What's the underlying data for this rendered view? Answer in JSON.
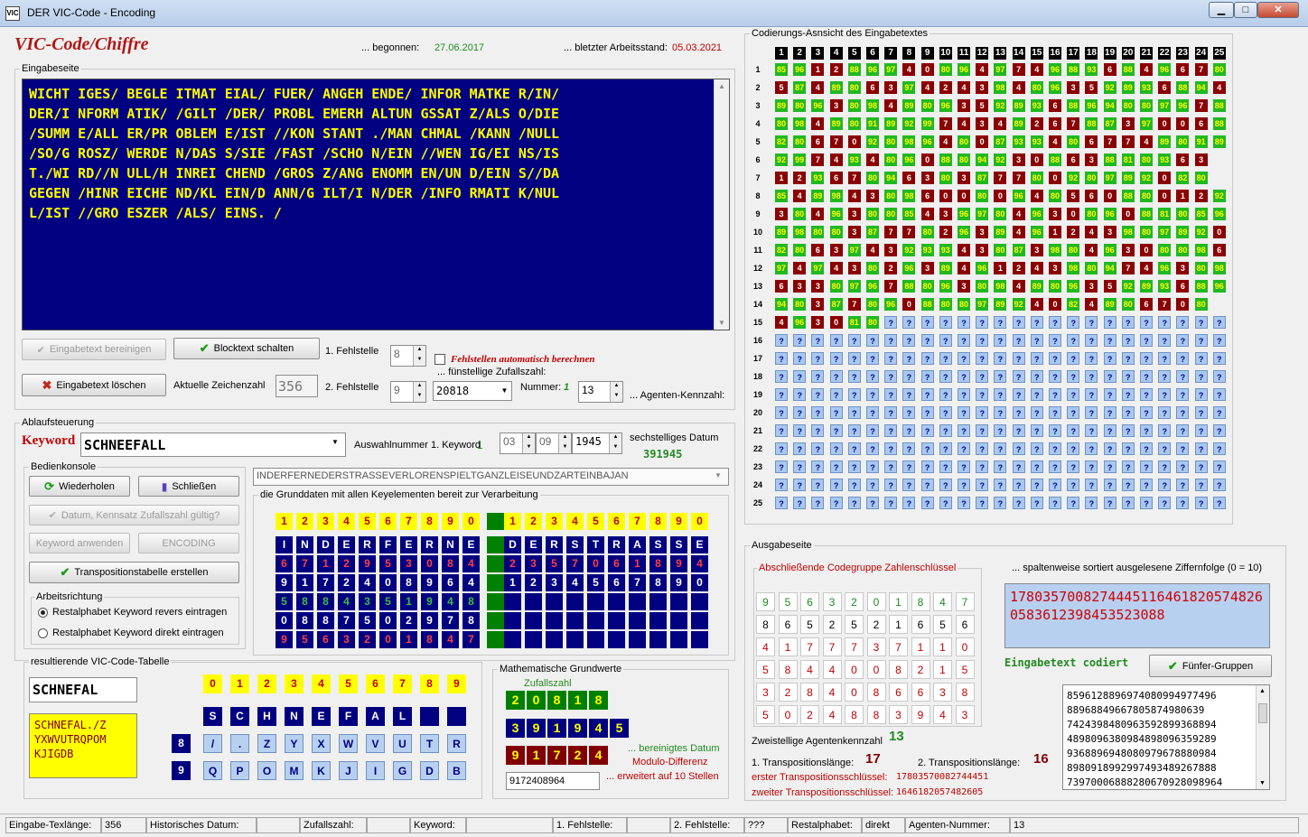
{
  "window": {
    "title": "DER VIC-Code - Encoding",
    "icon_text": "VIC",
    "min": "▁",
    "max": "□",
    "close": "✕"
  },
  "header": {
    "app_title": "VIC-Code/Chiffre",
    "started_label": "... begonnen:",
    "started": "27.06.2017",
    "last_label": "... bletzter Arbeitsstand:",
    "last": "05.03.2021"
  },
  "input": {
    "group_label": "Eingabeseite",
    "lines": [
      "WICHT IGES/ BEGLE ITMAT EIAL/ FUER/ ANGEH ENDE/ INFOR MATKE R/IN/",
      "DER/I NFORM ATIK/ /GILT /DER/ PROBL EMERH ALTUN GSSAT Z/ALS O/DIE",
      "/SUMM E/ALL ER/PR OBLEM E/IST //KON STANT ./MAN CHMAL /KANN /NULL",
      "/SO/G ROSZ/ WERDE N/DAS S/SIE /FAST /SCHO N/EIN //WEN IG/EI NS/IS",
      "T./WI RD//N ULL/H INREI CHEND /GROS Z/ANG ENOMM EN/UN D/EIN S//DA",
      "GEGEN /HINR EICHE ND/KL EIN/D ANN/G ILT/I N/DER /INFO RMATI K/NUL",
      "L/IST //GRO ESZER /ALS/ EINS. /"
    ],
    "btn_clean": "Eingabetext bereinigen",
    "btn_block": "Blocktext schalten",
    "btn_delete": "Eingabetext löschen",
    "char_label": "Aktuelle Zeichenzahl",
    "char_count": "356",
    "err1_label": "1. Fehlstelle",
    "err1": "8",
    "err2_label": "2. Fehlstelle",
    "err2": "9",
    "auto_label": "Fehlstellen automatisch berechnen",
    "random_label": "... fünstellige Zufallszahl:",
    "random": "20818",
    "number_label": "Nummer:",
    "number_val": "1",
    "agent_num": "13",
    "agent_label": "... Agenten-Kennzahl:"
  },
  "flow": {
    "group_label": "Ablaufsteuerung",
    "keyword_label": "Keyword",
    "keyword": "SCHNEEFALL",
    "select_label": "Auswahlnummer 1. Keyword",
    "select_val": "1",
    "date_day": "03",
    "date_month": "09",
    "date_year": "1945",
    "date6_label": "sechstelliges Datum",
    "date6": "391945",
    "phrase": "INDERFERNEDERSTRASSEVERLORENSPIELTGANZLEISEUNDZARTEINBAJAN",
    "console_label": "Bedienkonsole",
    "btn_repeat": "Wiederholen",
    "btn_close": "Schließen",
    "btn_date": "Datum, Kennsatz Zufallszahl gültig?",
    "btn_keyword": "Keyword anwenden",
    "btn_encoding": "ENCODING",
    "btn_transp": "Transpositionstabelle erstellen",
    "direction_label": "Arbeitsrichtung",
    "radio1": "Restalphabet Keyword revers eintragen",
    "radio2": "Restalphabet Keyword direkt eintragen",
    "base_label": "die Grunddaten mit allen Keyelementen bereit zur Verarbeitung"
  },
  "keygrid": {
    "header_left": [
      "1",
      "2",
      "3",
      "4",
      "5",
      "6",
      "7",
      "8",
      "9",
      "0"
    ],
    "header_right": [
      "1",
      "2",
      "3",
      "4",
      "5",
      "6",
      "7",
      "8",
      "9",
      "0"
    ],
    "rows": [
      {
        "color": "white",
        "left": [
          "I",
          "N",
          "D",
          "E",
          "R",
          "F",
          "E",
          "R",
          "N",
          "E"
        ],
        "right": [
          "D",
          "E",
          "R",
          "S",
          "T",
          "R",
          "A",
          "S",
          "S",
          "E"
        ]
      },
      {
        "color": "red",
        "left": [
          "6",
          "7",
          "1",
          "2",
          "9",
          "5",
          "3",
          "0",
          "8",
          "4"
        ],
        "right": [
          "2",
          "3",
          "5",
          "7",
          "0",
          "6",
          "1",
          "8",
          "9",
          "4"
        ]
      },
      {
        "color": "white",
        "left": [
          "9",
          "1",
          "7",
          "2",
          "4",
          "0",
          "8",
          "9",
          "6",
          "4"
        ],
        "right": [
          "1",
          "2",
          "3",
          "4",
          "5",
          "6",
          "7",
          "8",
          "9",
          "0"
        ]
      },
      {
        "color": "green",
        "left": [
          "5",
          "8",
          "8",
          "4",
          "3",
          "5",
          "1",
          "9",
          "4",
          "8"
        ],
        "right": [
          "",
          "",
          "",
          "",
          "",
          "",
          "",
          "",
          "",
          ""
        ]
      },
      {
        "color": "white",
        "left": [
          "0",
          "8",
          "8",
          "7",
          "5",
          "0",
          "2",
          "9",
          "7",
          "8"
        ],
        "right": [
          "",
          "",
          "",
          "",
          "",
          "",
          "",
          "",
          "",
          ""
        ]
      },
      {
        "color": "red",
        "left": [
          "9",
          "5",
          "6",
          "3",
          "2",
          "0",
          "1",
          "8",
          "4",
          "7"
        ],
        "right": [
          "",
          "",
          "",
          "",
          "",
          "",
          "",
          "",
          "",
          ""
        ]
      }
    ]
  },
  "vic_table": {
    "group_label": "resultierende VIC-Code-Tabelle",
    "key_short": "SCHNEFAL",
    "alphabet": "SCHNEFAL./Z\nYXWVUTRQPOM\nKJIGDB",
    "header": [
      "0",
      "1",
      "2",
      "3",
      "4",
      "5",
      "6",
      "7",
      "8",
      "9"
    ],
    "row0": [
      "S",
      "C",
      "H",
      "N",
      "E",
      "F",
      "A",
      "L",
      "",
      ""
    ],
    "row8_label": "8",
    "row8": [
      "/",
      ".",
      "Z",
      "Y",
      "X",
      "W",
      "V",
      "U",
      "T",
      "R"
    ],
    "row9_label": "9",
    "row9": [
      "Q",
      "P",
      "O",
      "M",
      "K",
      "J",
      "I",
      "G",
      "D",
      "B"
    ]
  },
  "math": {
    "group_label": "Mathematische Grundwerte",
    "random_label": "Zufallszahl",
    "row1": [
      "2",
      "0",
      "8",
      "1",
      "8"
    ],
    "row2": [
      "3",
      "9",
      "1",
      "9",
      "4",
      "5"
    ],
    "row3": [
      "9",
      "1",
      "7",
      "2",
      "4"
    ],
    "date_label": "... bereinigtes Datum",
    "modulo_label": "Modulo-Differenz",
    "extended": "9172408964",
    "extended_label": "... erweitert auf 10 Stellen"
  },
  "coding": {
    "group_label": "Codierungs-Asnsicht des Eingabetextes",
    "headers": [
      "1",
      "2",
      "3",
      "4",
      "5",
      "6",
      "7",
      "8",
      "9",
      "10",
      "11",
      "12",
      "13",
      "14",
      "15",
      "16",
      "17",
      "18",
      "19",
      "20",
      "21",
      "22",
      "23",
      "24",
      "25"
    ],
    "rows": [
      "85 96 1 2 88 96 97 4 0 80 96 4 97 7 4 96 88 93 6 88 4 96 6 7 80",
      "5 87 4 89 80 6 3 97 4 2 4 3 98 4 80 96 3 5 92 89 93 6 88 94 4",
      "89 80 96 3 80 98 4 89 80 96 3 5 92 89 93 6 88 96 94 80 80 97 96 7 88",
      "80 98 4 89 80 91 89 92 99 7 4 3 4 89 2 6 7 88 87 3 97 0 0 6 88",
      "82 80 6 7 0 92 80 98 96 4 80 0 87 93 93 4 80 6 7 7 4 89 80 91 89",
      "92 99 7 4 93 4 80 96 0 88 80 94 92 3 0 88 6 3 88 81 80 93 6 3",
      "1 2 93 6 7 80 94 6 3 80 3 87 7 7 80 0 92 80 97 89 92 0 82 80",
      "85 4 89 98 4 3 80 98 6 0 0 80 0 96 4 80 5 6 0 88 80 0 1 2 92",
      "3 80 4 96 3 80 80 85 4 3 96 97 80 4 96 3 0 80 96 0 88 81 80 85 96",
      "89 98 80 80 3 87 7 7 80 2 96 3 89 4 96 1 2 4 3 98 80 97 89 92 0",
      "82 80 6 3 97 4 3 92 93 93 4 3 80 87 3 98 80 4 96 3 0 80 80 98 6",
      "97 4 97 4 3 80 2 96 3 89 4 96 1 2 4 3 98 80 94 7 4 96 3 80 98",
      "6 3 3 80 97 96 7 88 80 96 3 80 98 4 89 80 96 3 5 92 89 93 6 88 96",
      "94 80 3 87 7 80 96 0 88 80 80 97 89 92 4 0 82 4 89 80 6 7 0 80",
      "4 96 3 0 81 80 ? ? ? ? ? ? ? ? ? ? ? ? ? ? ? ? ? ? ?",
      "? ? ? ? ? ? ? ? ? ? ? ? ? ? ? ? ? ? ? ? ? ? ? ? ?",
      "? ? ? ? ? ? ? ? ? ? ? ? ? ? ? ? ? ? ? ? ? ? ? ? ?",
      "? ? ? ? ? ? ? ? ? ? ? ? ? ? ? ? ? ? ? ? ? ? ? ? ?",
      "? ? ? ? ? ? ? ? ? ? ? ? ? ? ? ? ? ? ? ? ? ? ? ? ?",
      "? ? ? ? ? ? ? ? ? ? ? ? ? ? ? ? ? ? ? ? ? ? ? ? ?",
      "? ? ? ? ? ? ? ? ? ? ? ? ? ? ? ? ? ? ? ? ? ? ? ? ?",
      "? ? ? ? ? ? ? ? ? ? ? ? ? ? ? ? ? ? ? ? ? ? ? ? ?",
      "? ? ? ? ? ? ? ? ? ? ? ? ? ? ? ? ? ? ? ? ? ? ? ? ?",
      "? ? ? ? ? ? ? ? ? ? ? ? ? ? ? ? ? ? ? ? ? ? ? ? ?",
      "? ? ? ? ? ? ? ? ? ? ? ? ? ? ? ? ? ? ? ? ? ? ? ? ?"
    ]
  },
  "output": {
    "group_label": "Ausgabeseite",
    "final_label": "Abschließende Codegruppe Zahlenschlüssel",
    "final_rows": [
      {
        "color": "green",
        "vals": [
          "9",
          "5",
          "6",
          "3",
          "2",
          "0",
          "1",
          "8",
          "4",
          "7"
        ]
      },
      {
        "color": "black",
        "vals": [
          "8",
          "6",
          "5",
          "2",
          "5",
          "2",
          "1",
          "6",
          "5",
          "6"
        ]
      },
      {
        "color": "red",
        "vals": [
          "4",
          "1",
          "7",
          "7",
          "7",
          "3",
          "7",
          "1",
          "1",
          "0"
        ]
      },
      {
        "color": "red",
        "vals": [
          "5",
          "8",
          "4",
          "4",
          "0",
          "0",
          "8",
          "2",
          "1",
          "5"
        ]
      },
      {
        "color": "red",
        "vals": [
          "3",
          "2",
          "8",
          "4",
          "0",
          "8",
          "6",
          "6",
          "3",
          "8"
        ]
      },
      {
        "color": "red",
        "vals": [
          "5",
          "0",
          "2",
          "4",
          "8",
          "8",
          "3",
          "9",
          "4",
          "3"
        ]
      }
    ],
    "sorted_label": "... spaltenweise sortiert ausgelesene Ziffernfolge (0 = 10)",
    "sorted": "17803570082744451164618205748260583612398453523088",
    "encoded_label": "Eingabetext codiert",
    "btn_groups": "Fünfer-Gruppen",
    "groups": [
      "85961288969740809949 77496",
      "88968849667805874980639",
      "74243984809635928993 68894",
      "48980963809848980963 59289",
      "93688969480809796788 80984",
      "89809189929974934892 67888",
      "73970006888280670928098964"
    ],
    "agent_label": "Zweistellige Agentenkennzahl",
    "agent": "13",
    "t1_label": "1. Transpositionslänge:",
    "t1": "17",
    "t2_label": "2. Transpositionslänge:",
    "t2": "16",
    "k1_label": "erster Transpositionsschlüssel:",
    "k1": "17803570082744451",
    "k2_label": "zweiter Transpositionsschlüssel:",
    "k2": "1646182057482605"
  },
  "status": {
    "len_label": "Eingabe-Texlänge:",
    "len": "356",
    "hist_label": "Historisches Datum:",
    "hist": "",
    "rand_label": "Zufallszahl:",
    "rand": "",
    "kw_label": "Keyword:",
    "kw": "",
    "e1_label": "1. Fehlstelle:",
    "e1": "",
    "e2_label": "2. Fehlstelle:",
    "e2": "???",
    "rest_label": "Restalphabet:",
    "rest": "direkt",
    "ag_label": "Agenten-Nummer:",
    "ag": "13"
  },
  "colors": {
    "navy": "#000080",
    "green": "#008000",
    "red": "#800000",
    "yellow": "#ffff00",
    "light": "#b8d0f0"
  }
}
